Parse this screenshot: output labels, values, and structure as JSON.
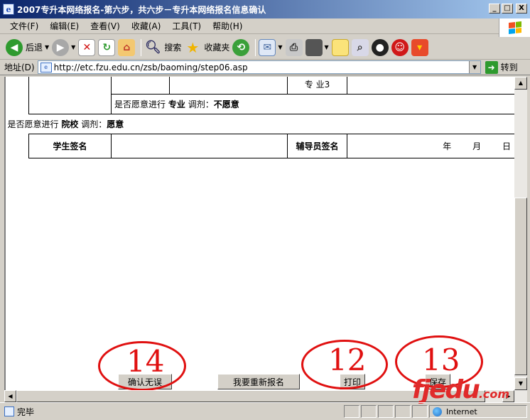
{
  "window": {
    "title": "2007专升本网络报名-第六步，共六步－专升本网络报名信息确认",
    "btn_min": "_",
    "btn_max": "□",
    "btn_close": "X"
  },
  "menu": {
    "items": [
      "文件(F)",
      "编辑(E)",
      "查看(V)",
      "收藏(A)",
      "工具(T)",
      "帮助(H)"
    ]
  },
  "toolbar": {
    "back_label": "后退",
    "search_label": "搜索",
    "favorites_label": "收藏夹"
  },
  "address": {
    "label": "地址(D)",
    "url": "http://etc.fzu.edu.cn/zsb/baoming/step06.asp",
    "go_label": "转到"
  },
  "form": {
    "major3_label": "专 业3",
    "adjust_major_prefix": "是否愿意进行",
    "adjust_major_word": "专业",
    "adjust_major_mid": "调剂：",
    "adjust_major_value": "不愿意",
    "adjust_school_prefix": "是否愿意进行",
    "adjust_school_word": "院校",
    "adjust_school_mid": "调剂：",
    "adjust_school_value": "愿意",
    "student_sign": "学生签名",
    "counselor_sign": "辅导员签名",
    "date_year": "年",
    "date_month": "月",
    "date_day": "日"
  },
  "buttons": {
    "confirm": "确认无误",
    "reapply": "我要重新报名",
    "print": "打印",
    "save": "保存"
  },
  "annotations": {
    "confirm_num": "14",
    "print_num": "12",
    "save_num": "13"
  },
  "watermark": {
    "brand": "fjedu",
    "suffix": ".com"
  },
  "status": {
    "text": "完毕",
    "zone": "Internet"
  }
}
